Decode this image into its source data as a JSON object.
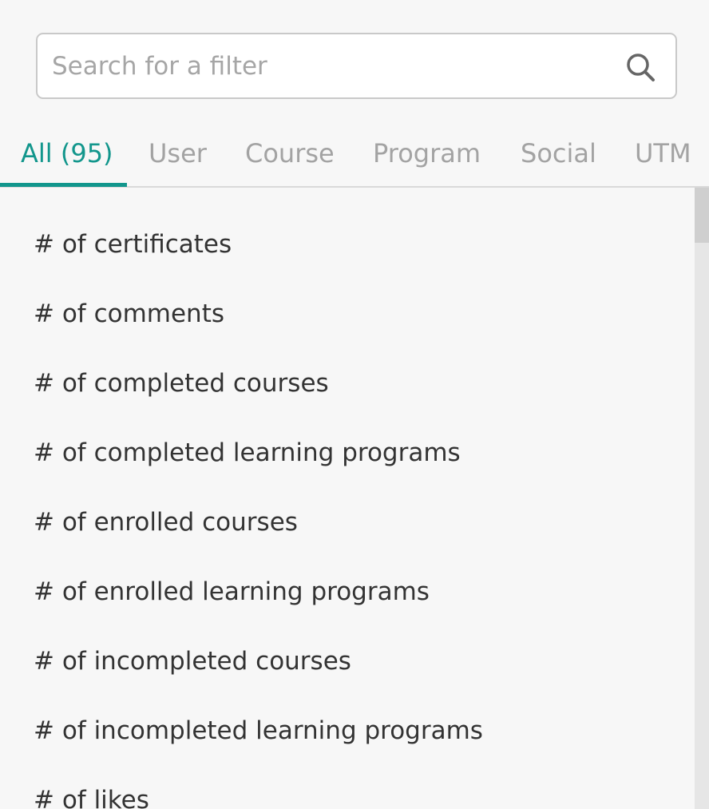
{
  "search": {
    "placeholder": "Search for a filter",
    "value": "",
    "icon": "search-icon"
  },
  "tabs": [
    {
      "label": "All (95)",
      "active": true
    },
    {
      "label": "User",
      "active": false
    },
    {
      "label": "Course",
      "active": false
    },
    {
      "label": "Program",
      "active": false
    },
    {
      "label": "Social",
      "active": false
    },
    {
      "label": "UTM",
      "active": false
    }
  ],
  "filters": [
    "# of certificates",
    "# of comments",
    "# of completed courses",
    "# of completed learning programs",
    "# of enrolled courses",
    "# of enrolled learning programs",
    "# of incompleted courses",
    "# of incompleted learning programs",
    "# of likes"
  ],
  "colors": {
    "accent": "#12968c",
    "inactive_tab": "#a3a3a3",
    "text": "#333333",
    "background": "#f7f7f7"
  }
}
